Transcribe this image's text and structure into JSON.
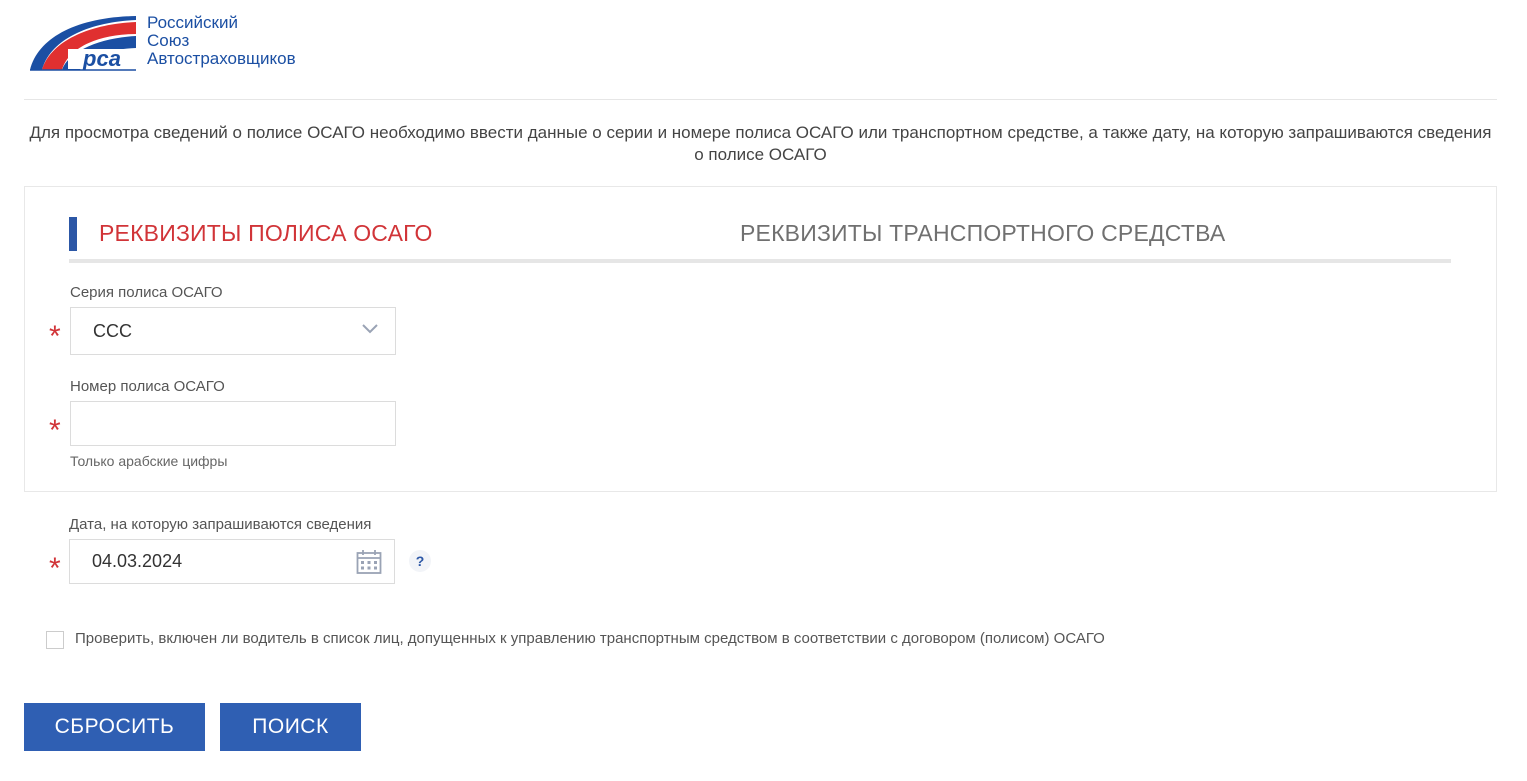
{
  "logo": {
    "line1": "Российский",
    "line2": "Союз",
    "line3": "Автостраховщиков",
    "emblem_text": "рса"
  },
  "intro_text": "Для просмотра сведений о полисе ОСАГО необходимо ввести данные о серии и номере полиса ОСАГО или транспортном средстве, а также дату, на которую запрашиваются сведения о полисе ОСАГО",
  "tabs": [
    {
      "label": "РЕКВИЗИТЫ ПОЛИСА ОСАГО",
      "active": true
    },
    {
      "label": "РЕКВИЗИТЫ ТРАНСПОРТНОГО СРЕДСТВА",
      "active": false
    }
  ],
  "series_field": {
    "label": "Серия полиса ОСАГО",
    "value": "ССС"
  },
  "number_field": {
    "label": "Номер полиса ОСАГО",
    "value": "",
    "hint": "Только арабские цифры"
  },
  "date_field": {
    "label": "Дата, на которую запрашиваются сведения",
    "value": "04.03.2024"
  },
  "required_mark": "*",
  "help_mark": "?",
  "driver_check": {
    "label": "Проверить, включен ли водитель в список лиц, допущенных к управлению транспортным средством в соответствии с договором (полисом) ОСАГО",
    "checked": false
  },
  "buttons": {
    "reset": "СБРОСИТЬ",
    "search": "ПОИСК"
  },
  "colors": {
    "brand_blue": "#2f5fb3",
    "accent_red": "#d13438",
    "logo_red": "#e03030",
    "logo_blue": "#1b4fa3"
  },
  "icons": {
    "select_arrow": "chevron-down-icon",
    "date_picker": "calendar-icon"
  }
}
